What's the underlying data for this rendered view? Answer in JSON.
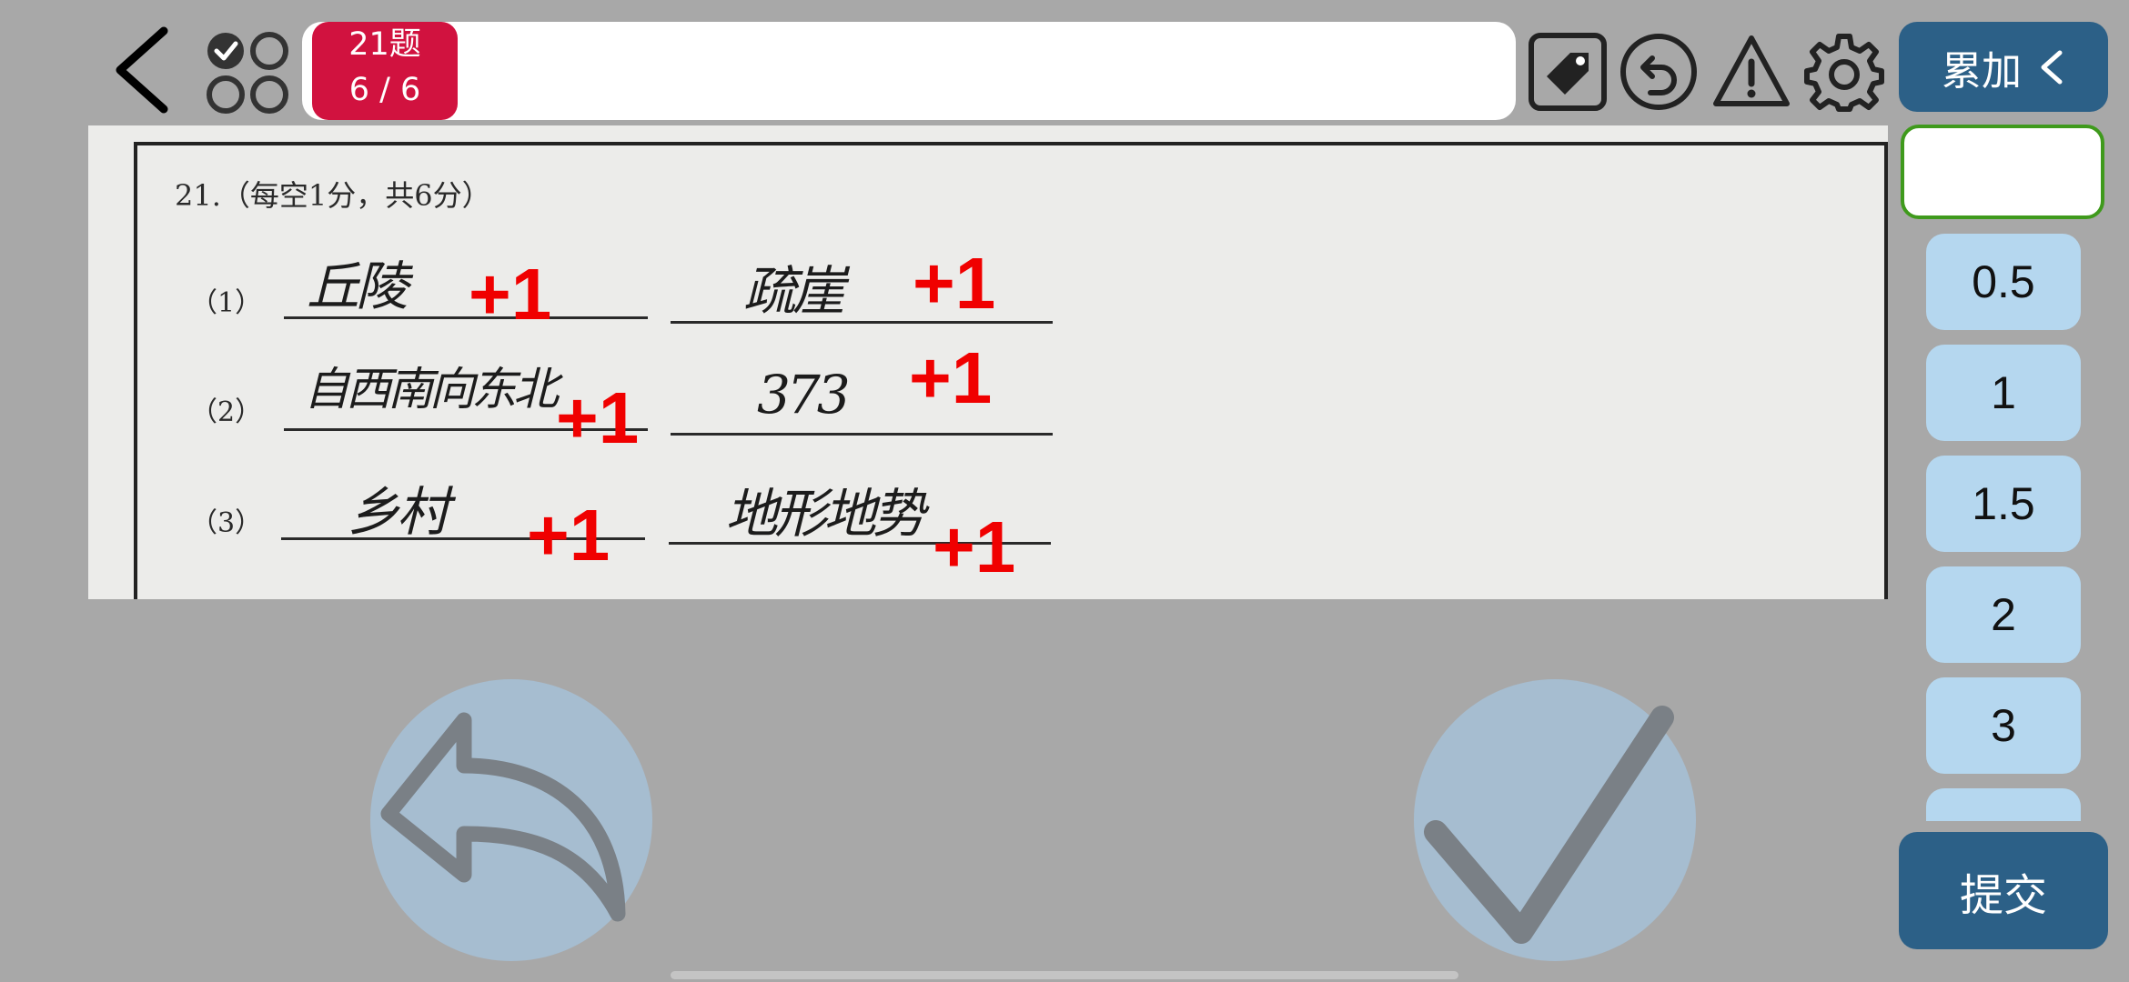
{
  "header": {
    "question_label": "21题",
    "progress": "6 / 6"
  },
  "mode": {
    "label": "累加"
  },
  "paper": {
    "question_header": "21.（每空1分，共6分）",
    "rows": [
      {
        "label": "（1）",
        "answer_left": "丘陵",
        "answer_right": "疏崖"
      },
      {
        "label": "（2）",
        "answer_left": "自西南向东北",
        "answer_right": "373"
      },
      {
        "label": "（3）",
        "answer_left": "乡村",
        "answer_right": "地形地势"
      }
    ],
    "score_marks": [
      "+1",
      "+1",
      "+1",
      "+1",
      "+1",
      "+1"
    ]
  },
  "score_panel": {
    "input_value": "",
    "options": [
      "0.5",
      "1",
      "1.5",
      "2",
      "3"
    ],
    "submit_label": "提交"
  },
  "colors": {
    "accent": "#2c6087",
    "badge": "#d1123f",
    "score_mark": "#f00000",
    "option_bg": "#b5d7ef",
    "input_border": "#3f9a1c"
  },
  "icons": {
    "back": "chevron-left-icon",
    "grid": "question-grid-icon",
    "tag": "tag-icon",
    "undo": "undo-icon",
    "warning": "warning-icon",
    "settings": "gear-icon",
    "previous": "reply-arrow-icon",
    "confirm": "checkmark-icon"
  }
}
